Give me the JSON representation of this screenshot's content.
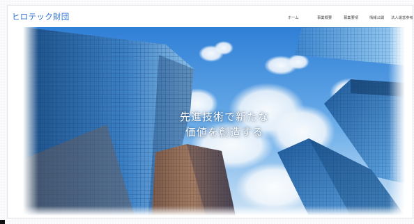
{
  "header": {
    "logo_text": "ヒロテック財団",
    "nav": [
      {
        "label": "ホーム",
        "icon": null
      },
      {
        "label": "事業概要",
        "icon": null
      },
      {
        "label": "募集要項",
        "icon": null
      },
      {
        "label": "情報公開",
        "icon": null
      },
      {
        "label": "法人運営参考",
        "icon": null
      }
    ]
  },
  "hero": {
    "headline_line1": "先進技術で新たな",
    "headline_line2": "価値を創造する",
    "scene": "low-angle photo of glass skyscrapers against a blue sky with clouds"
  },
  "colors": {
    "brand": "#2f6fd1",
    "sky": "#3f8fe0",
    "nav_text": "#444444"
  }
}
